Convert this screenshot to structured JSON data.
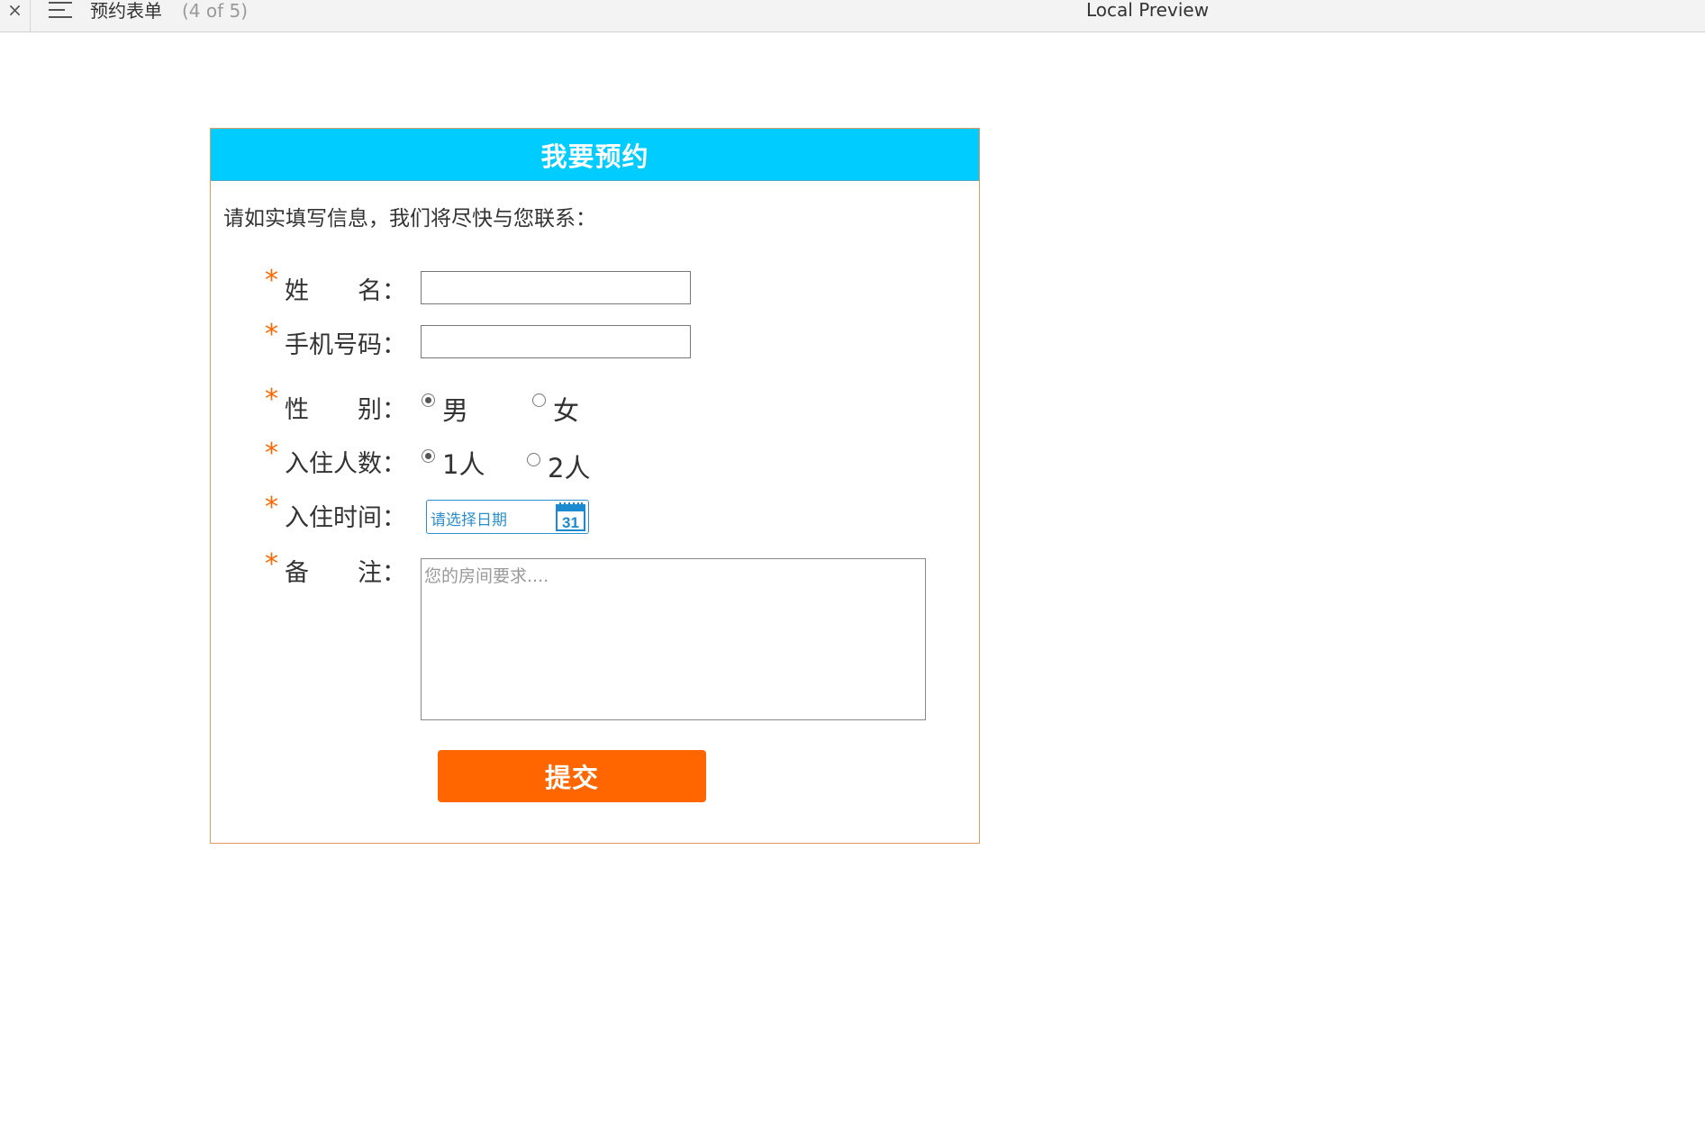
{
  "topbar": {
    "close_glyph": "×",
    "tab_title": "预约表单",
    "tab_count": "(4 of 5)",
    "window_title": "Local Preview"
  },
  "form": {
    "header_title": "我要预约",
    "intro": "请如实填写信息，我们将尽快与您联系：",
    "required_mark": "*",
    "fields": {
      "name": {
        "label": "姓　　名："
      },
      "phone": {
        "label": "手机号码："
      },
      "gender": {
        "label": "性　　别：",
        "options": [
          "男",
          "女"
        ],
        "selected": "男"
      },
      "guests": {
        "label": "入住人数：",
        "options": [
          "1人",
          "2人"
        ],
        "selected": "1人"
      },
      "checkin": {
        "label": "入住时间：",
        "placeholder": "请选择日期",
        "calendar_icon_text": "31"
      },
      "remarks": {
        "label": "备　　注：",
        "placeholder": "您的房间要求...."
      }
    },
    "submit_label": "提交"
  },
  "colors": {
    "header_bg": "#00ccff",
    "accent": "#ff6600",
    "date_blue": "#2b8fce",
    "card_border": "#e09a5a"
  },
  "icons": {
    "close": "close-icon",
    "menu": "menu-icon",
    "calendar": "calendar-icon"
  }
}
